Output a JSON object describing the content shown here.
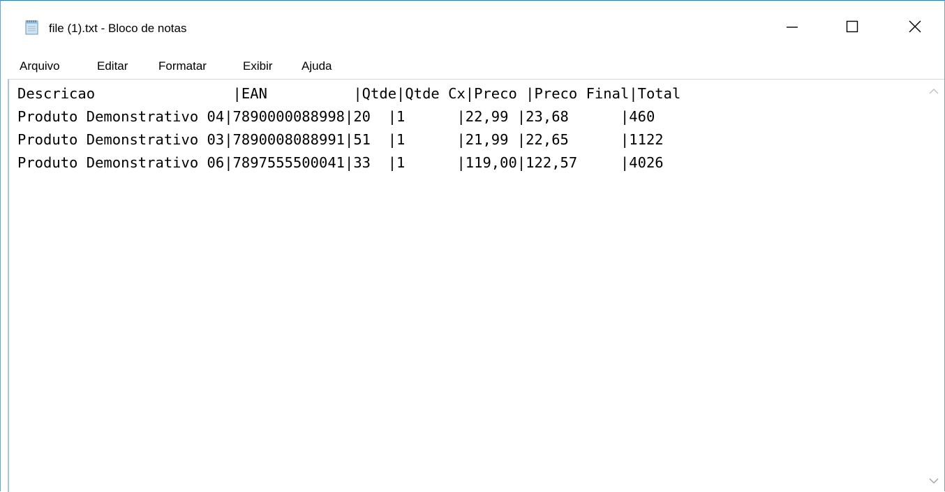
{
  "window": {
    "title": "file (1).txt - Bloco de notas",
    "icon": "notepad-icon",
    "controls": {
      "minimize": "minimize-icon",
      "maximize": "maximize-icon",
      "close": "close-icon"
    }
  },
  "menu": {
    "items": [
      {
        "label": "Arquivo"
      },
      {
        "label": "Editar"
      },
      {
        "label": "Formatar"
      },
      {
        "label": "Exibir"
      },
      {
        "label": "Ajuda"
      }
    ]
  },
  "document": {
    "lines": [
      "Descricao                |EAN          |Qtde|Qtde Cx|Preco |Preco Final|Total",
      "Produto Demonstrativo 04|7890000088998|20  |1      |22,99 |23,68      |460",
      "Produto Demonstrativo 03|7890008088991|51  |1      |21,99 |22,65      |1122",
      "Produto Demonstrativo 06|7897555500041|33  |1      |119,00|122,57     |4026"
    ]
  },
  "scrollbar": {
    "up": "chevron-up-icon",
    "down": "chevron-down-icon"
  },
  "colors": {
    "window_border": "#2b79c2",
    "background": "#ffffff",
    "text": "#000000"
  }
}
